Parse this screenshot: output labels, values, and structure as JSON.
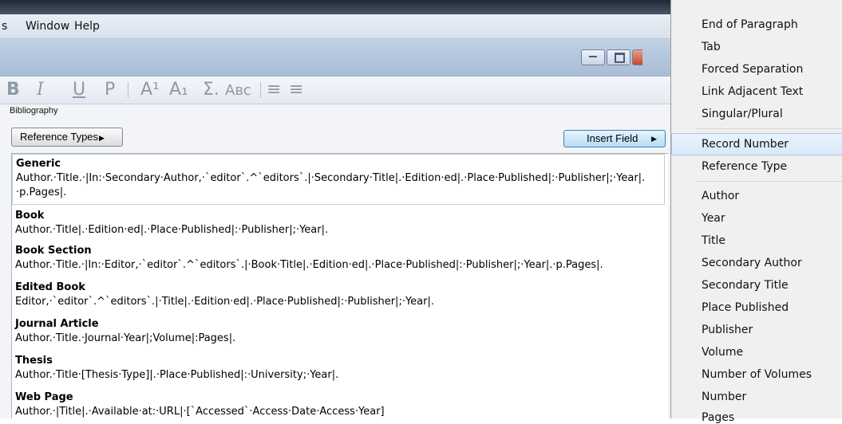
{
  "menubar": {
    "items": [
      "s",
      "Window",
      "Help"
    ]
  },
  "toolbar": {
    "bold": "B",
    "italic": "I",
    "underline": "U",
    "plain": "P",
    "superscript": "A¹",
    "subscript": "A₁",
    "symbol": "Σ.",
    "smallcaps": "Aʙᴄ",
    "align_left": "≡",
    "justify": "≡"
  },
  "panel": {
    "bibliography_label": "Bibliography",
    "reference_types_button": "Reference Types",
    "insert_field_button": "Insert Field"
  },
  "templates": [
    {
      "type": "Generic",
      "lines": [
        "Author.·Title.·|In:·Secondary·Author,·`editor`.^`editors`.|·Secondary·Title|.·Edition·ed|.·Place·Published|:·Publisher|;·Year|.",
        "·p.Pages|."
      ]
    },
    {
      "type": "Book",
      "lines": [
        "Author.·Title|.·Edition·ed|.·Place·Published|:·Publisher|;·Year|."
      ]
    },
    {
      "type": "Book Section",
      "lines": [
        "Author.·Title.·|In:·Editor,·`editor`.^`editors`.|·Book·Title|.·Edition·ed|.·Place·Published|:·Publisher|;·Year|.·p.Pages|."
      ]
    },
    {
      "type": "Edited Book",
      "lines": [
        "Editor,·`editor`.^`editors`.|·Title|.·Edition·ed|.·Place·Published|:·Publisher|;·Year|."
      ]
    },
    {
      "type": "Journal Article",
      "lines": [
        "Author.·Title.·Journal·Year|;Volume|:Pages|."
      ]
    },
    {
      "type": "Thesis",
      "lines": [
        "Author.·Title·[Thesis·Type]|.·Place·Published|:·University;·Year|."
      ]
    },
    {
      "type": "Web Page",
      "lines": [
        "Author.·|Title|.·Available·at:·URL|·[`Accessed`·Access·Date·Access·Year]"
      ]
    }
  ],
  "insert_field_menu": {
    "group1": [
      "End of Paragraph",
      "Tab",
      "Forced Separation",
      "Link Adjacent Text",
      "Singular/Plural"
    ],
    "group2": [
      "Record Number",
      "Reference Type"
    ],
    "group3": [
      "Author",
      "Year",
      "Title",
      "Secondary Author",
      "Secondary Title",
      "Place Published",
      "Publisher",
      "Volume",
      "Number of Volumes",
      "Number",
      "Pages"
    ],
    "highlighted": "Record Number"
  }
}
